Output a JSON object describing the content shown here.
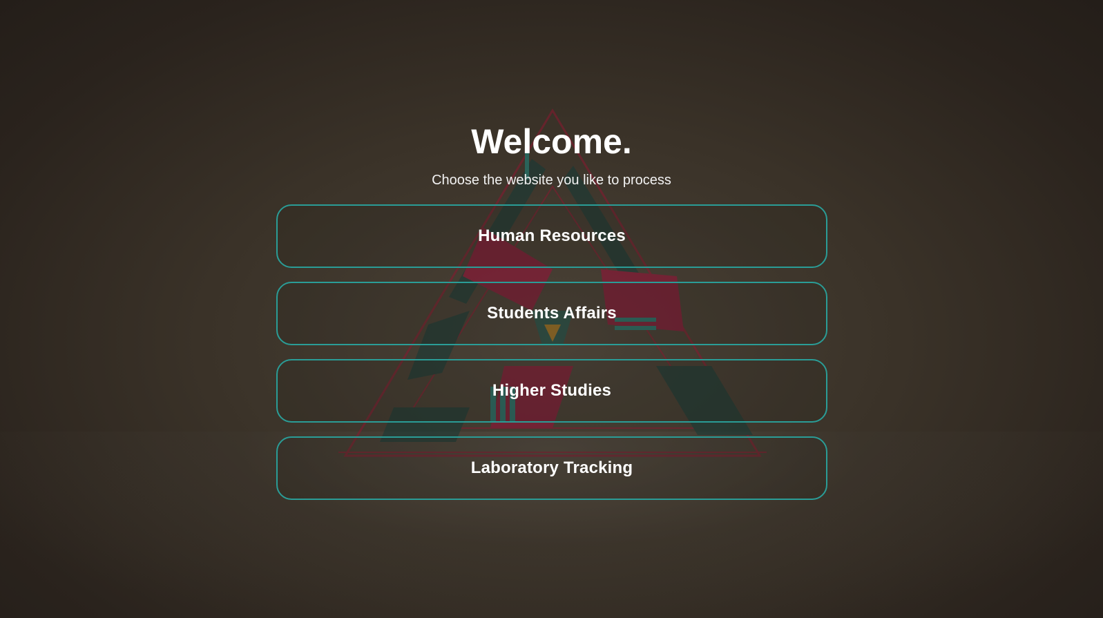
{
  "header": {
    "title": "Welcome.",
    "subtitle": "Choose the website you like to process"
  },
  "options": [
    {
      "label": "Human Resources"
    },
    {
      "label": "Students Affairs"
    },
    {
      "label": "Higher Studies"
    },
    {
      "label": "Laboratory Tracking"
    }
  ],
  "colors": {
    "button_border": "#2a9d97",
    "text": "#ffffff",
    "background": "#3a3228"
  }
}
